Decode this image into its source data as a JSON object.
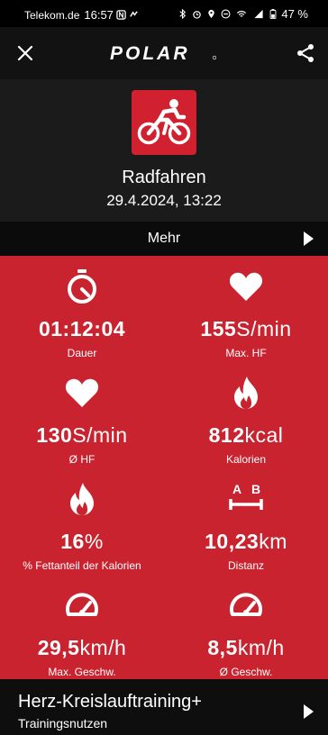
{
  "status_bar": {
    "carrier": "Telekom.de",
    "time": "16:57",
    "battery": "47 %"
  },
  "header": {
    "logo_text": "POLAR",
    "close_icon": "close-icon",
    "share_icon": "share-icon"
  },
  "activity": {
    "sport_icon": "cycling-icon",
    "name": "Radfahren",
    "datetime": "29.4.2024, 13:22"
  },
  "more": {
    "label": "Mehr"
  },
  "stats": [
    {
      "icon": "stopwatch-icon",
      "value": "01:12:04",
      "unit": "",
      "label": "Dauer"
    },
    {
      "icon": "heart-icon",
      "value": "155",
      "unit": "S/min",
      "label": "Max. HF"
    },
    {
      "icon": "heart-icon",
      "value": "130",
      "unit": "S/min",
      "label": "Ø HF"
    },
    {
      "icon": "flame-icon",
      "value": "812",
      "unit": "kcal",
      "label": "Kalorien"
    },
    {
      "icon": "flame-icon",
      "value": "16",
      "unit": "%",
      "label": "% Fettanteil der Kalorien"
    },
    {
      "icon": "distance-icon",
      "value": "10,23",
      "unit": "km",
      "label": "Distanz",
      "icon_letters": [
        "A",
        "B"
      ]
    },
    {
      "icon": "speedometer-icon",
      "value": "29,5",
      "unit": "km/h",
      "label": "Max. Geschw."
    },
    {
      "icon": "speedometer-icon",
      "value": "8,5",
      "unit": "km/h",
      "label": "Ø Geschw."
    }
  ],
  "training_benefit": {
    "title": "Herz-Kreislauftraining+",
    "subtitle": "Trainingsnutzen"
  },
  "colors": {
    "accent_red": "#c8232f",
    "icon_red": "#d1202f",
    "background": "#121212"
  }
}
